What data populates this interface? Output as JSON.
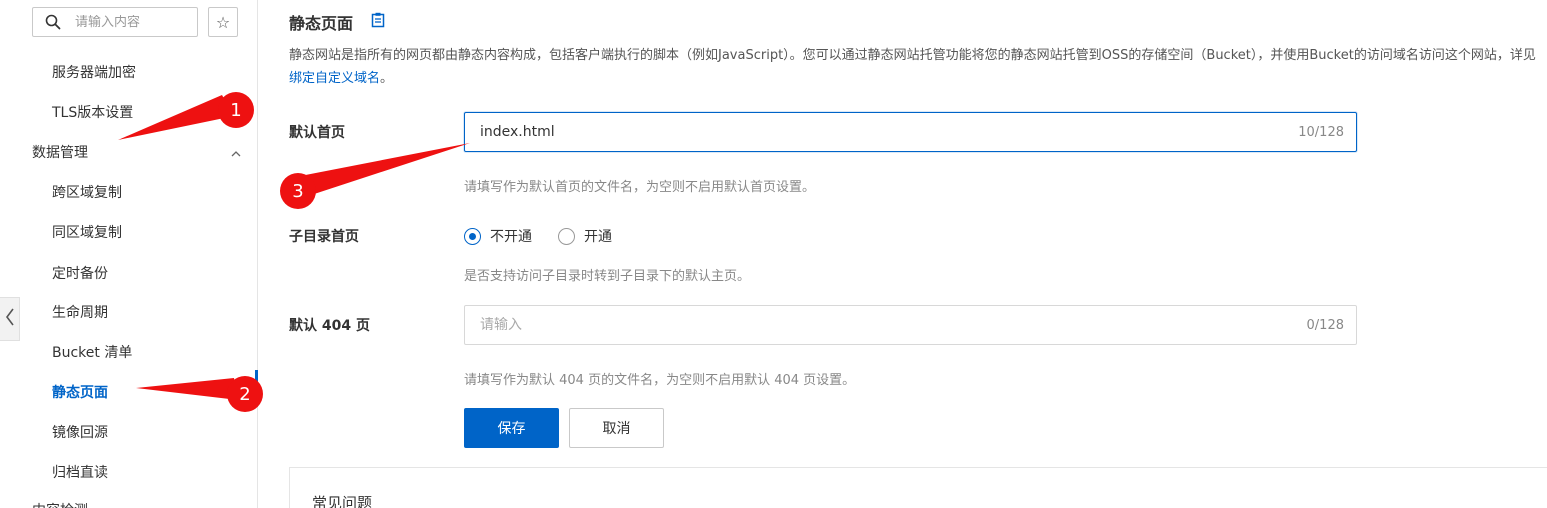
{
  "sidebar": {
    "search_placeholder": "请输入内容",
    "star_icon": "☆",
    "items": [
      {
        "label": "服务器端加密"
      },
      {
        "label": "TLS版本设置"
      },
      {
        "label": "数据管理"
      },
      {
        "label": "跨区域复制"
      },
      {
        "label": "同区域复制"
      },
      {
        "label": "定时备份"
      },
      {
        "label": "生命周期"
      },
      {
        "label": "Bucket 清单"
      },
      {
        "label": "静态页面"
      },
      {
        "label": "镜像回源"
      },
      {
        "label": "归档直读"
      },
      {
        "label": "内容检测"
      }
    ],
    "active_item": "静态页面"
  },
  "main": {
    "title": "静态页面",
    "description_part1": "静态网站是指所有的网页都由静态内容构成，包括客户端执行的脚本（例如JavaScript）。您可以通过静态网站托管功能将您的静态网站托管到OSS的存储空间（Bucket），并使用Bucket的访",
    "description_part2": "问域名访问这个网站，详见 ",
    "description_link": "绑定自定义域名",
    "description_end": "。",
    "form": {
      "default_index": {
        "label": "默认首页",
        "value": "index.html",
        "counter": "10/128",
        "help": "请填写作为默认首页的文件名，为空则不启用默认首页设置。"
      },
      "subdir_index": {
        "label": "子目录首页",
        "options": [
          "不开通",
          "开通"
        ],
        "selected": "不开通",
        "help": "是否支持访问子目录时转到子目录下的默认主页。"
      },
      "default_404": {
        "label": "默认 404 页",
        "placeholder": "请输入",
        "counter": "0/128",
        "help": "请填写作为默认 404 页的文件名，为空则不启用默认 404 页设置。"
      }
    },
    "buttons": {
      "save": "保存",
      "cancel": "取消"
    },
    "faq_title": "常见问题"
  },
  "annotations": {
    "badges": [
      "1",
      "2",
      "3"
    ],
    "color": "#ee1111"
  },
  "colors": {
    "accent": "#0064c8",
    "annotation": "#ee1111"
  }
}
